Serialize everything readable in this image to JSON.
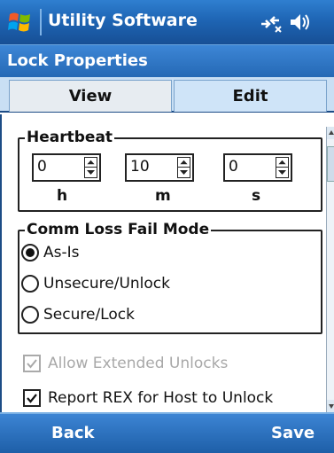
{
  "titlebar": {
    "app_title": "Utility Software",
    "start_icon": "windows-flag-icon",
    "connectivity_icon": "connectivity-icon",
    "volume_icon": "speaker-icon"
  },
  "header": {
    "title": "Lock Properties"
  },
  "tabs": [
    {
      "label": "View",
      "selected": false
    },
    {
      "label": "Edit",
      "selected": true
    }
  ],
  "heartbeat": {
    "legend": "Heartbeat",
    "fields": [
      {
        "value": "0",
        "unit": "h"
      },
      {
        "value": "10",
        "unit": "m"
      },
      {
        "value": "0",
        "unit": "s"
      }
    ]
  },
  "comm_loss": {
    "legend": "Comm Loss Fail Mode",
    "options": [
      {
        "label": "As-Is",
        "selected": true
      },
      {
        "label": "Unsecure/Unlock",
        "selected": false
      },
      {
        "label": "Secure/Lock",
        "selected": false
      }
    ]
  },
  "checkboxes": [
    {
      "label": "Allow Extended Unlocks",
      "checked": true,
      "enabled": false
    },
    {
      "label": "Report REX for Host to Unlock",
      "checked": true,
      "enabled": true
    }
  ],
  "softkeys": {
    "left": "Back",
    "right": "Save"
  },
  "colors": {
    "titlebar_blue": "#1e65b4",
    "softbar_blue": "#1e5fa8",
    "disabled_text": "#a8a8a8"
  }
}
